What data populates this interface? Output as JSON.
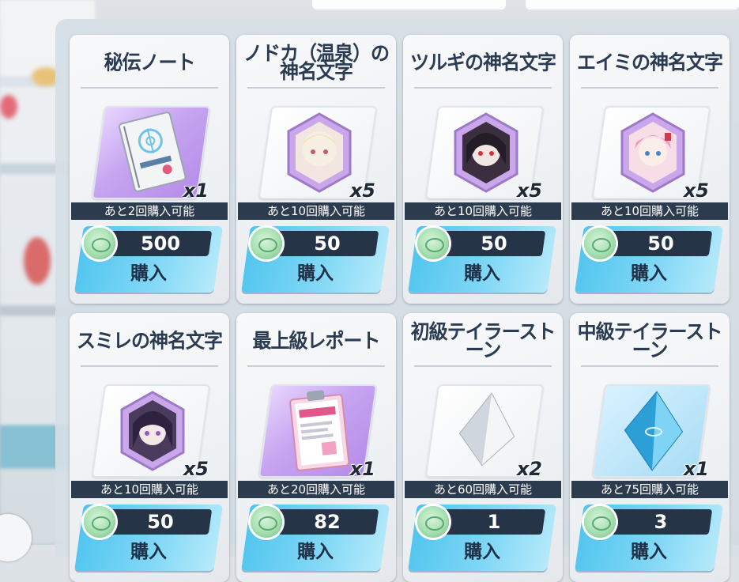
{
  "shop": {
    "cards": [
      {
        "title": "秘伝ノート",
        "qty": "x1",
        "limit": "あと2回購入可能",
        "price": "500",
        "buy": "購入",
        "item": "notebook-icon",
        "art": "purple"
      },
      {
        "title": "ノドカ（温泉）の神名文字",
        "qty": "x5",
        "limit": "あと10回購入可能",
        "price": "50",
        "buy": "購入",
        "item": "character-token-icon",
        "art": "gray"
      },
      {
        "title": "ツルギの神名文字",
        "qty": "x5",
        "limit": "あと10回購入可能",
        "price": "50",
        "buy": "購入",
        "item": "character-token-icon",
        "art": "gray"
      },
      {
        "title": "エイミの神名文字",
        "qty": "x5",
        "limit": "あと10回購入可能",
        "price": "50",
        "buy": "購入",
        "item": "character-token-icon",
        "art": "gray"
      },
      {
        "title": "スミレの神名文字",
        "qty": "x5",
        "limit": "あと10回購入可能",
        "price": "50",
        "buy": "購入",
        "item": "character-token-icon",
        "art": "gray"
      },
      {
        "title": "最上級レポート",
        "qty": "x1",
        "limit": "あと20回購入可能",
        "price": "82",
        "buy": "購入",
        "item": "report-clipboard-icon",
        "art": "purple"
      },
      {
        "title": "初級テイラーストーン",
        "qty": "x2",
        "limit": "あと60回購入可能",
        "price": "1",
        "buy": "購入",
        "item": "clear-crystal-icon",
        "art": "gray"
      },
      {
        "title": "中級テイラーストーン",
        "qty": "x1",
        "limit": "あと75回購入可能",
        "price": "3",
        "buy": "購入",
        "item": "blue-crystal-icon",
        "art": "blue"
      }
    ]
  },
  "colors": {
    "buy_button": "#4fc4ee",
    "price_bar": "#263447",
    "limit_bar": "#2c3b4e",
    "title_text": "#2a3b52"
  }
}
